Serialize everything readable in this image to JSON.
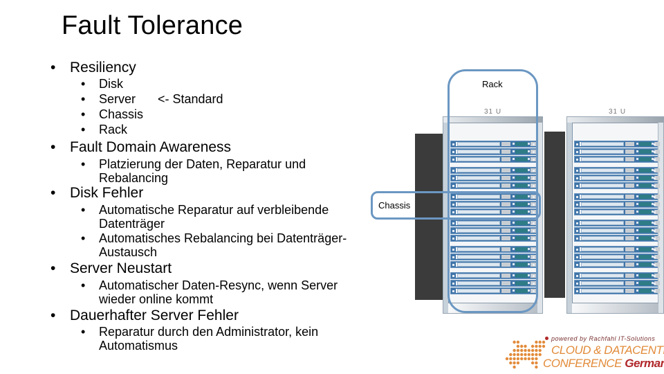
{
  "slide": {
    "title": "Fault Tolerance",
    "bullet_glyph": "•",
    "sections": [
      {
        "heading": "Resiliency",
        "items": [
          "Disk",
          "Server",
          "Chassis",
          "Rack"
        ],
        "server_note": "<- Standard"
      },
      {
        "heading": "Fault Domain Awareness",
        "items": [
          "Platzierung der Daten, Reparatur und Rebalancing"
        ]
      },
      {
        "heading": "Disk Fehler",
        "items": [
          "Automatische Reparatur auf verbleibende Datenträger",
          "Automatisches Rebalancing bei Datenträger-Austausch"
        ]
      },
      {
        "heading": "Server Neustart",
        "items": [
          "Automatischer Daten-Resync, wenn Server wieder online kommt"
        ]
      },
      {
        "heading": "Dauerhafter Server Fehler",
        "items": [
          "Reparatur durch den Administrator, kein Automatismus"
        ]
      }
    ]
  },
  "diagram": {
    "rack_callout": "Rack",
    "chassis_callout": "Chassis",
    "rack_unit_label": "31 U",
    "racks": 2,
    "chassis_per_rack": 6,
    "servers_per_chassis": 3,
    "colors": {
      "callout_outline": "#6b97c2",
      "server_blue": "#3f74a8",
      "server_green": "#2e7c86",
      "dark_panel": "#3b3b3b"
    }
  },
  "logo": {
    "powered_by": "powered by Rachfahl IT-Solutions",
    "line1": "CLOUD & DATACENTER",
    "line2_prefix": "CONFERENCE ",
    "line2_highlight": "Germany",
    "colors": {
      "orange": "#e28b3a",
      "red": "#b0272a"
    }
  }
}
